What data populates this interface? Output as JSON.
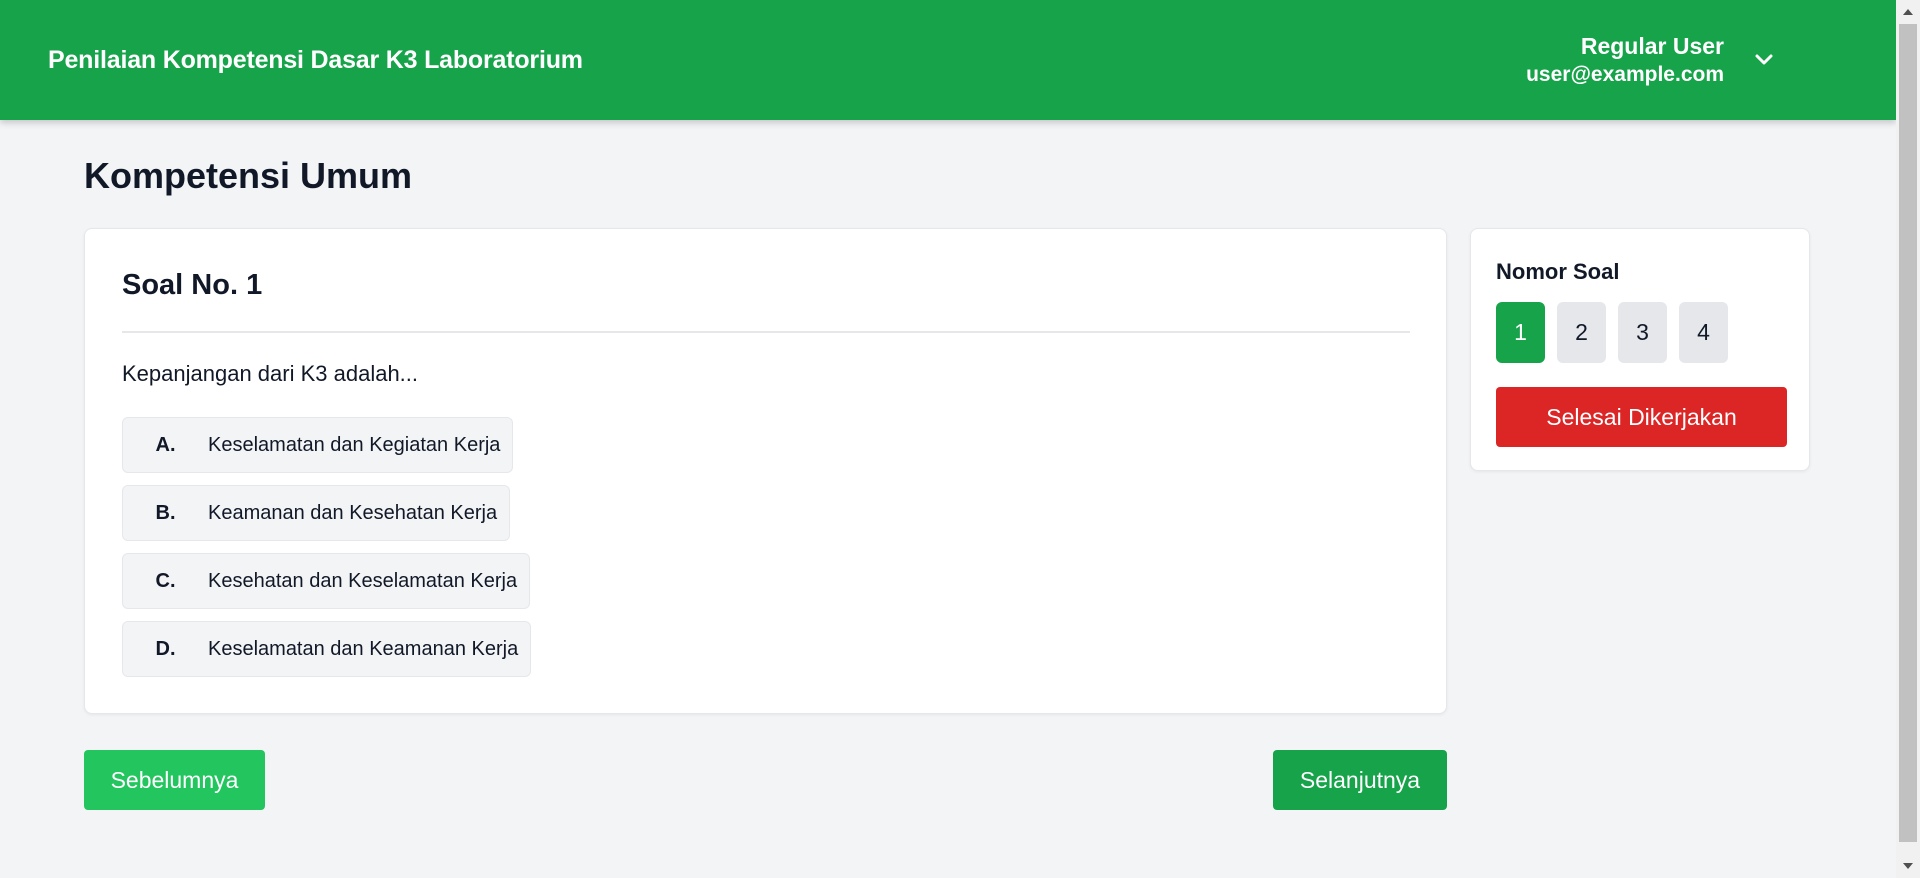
{
  "header": {
    "app_title": "Penilaian Kompetensi Dasar K3 Laboratorium",
    "user_name": "Regular User",
    "user_email": "user@example.com",
    "menu_icon": "chevron-down-icon"
  },
  "section": {
    "title": "Kompetensi Umum"
  },
  "question": {
    "number_label": "Soal No. 1",
    "text": "Kepanjangan dari K3 adalah...",
    "options": [
      {
        "letter": "A.",
        "text": "Keselamatan dan Kegiatan Kerja"
      },
      {
        "letter": "B.",
        "text": "Keamanan dan Kesehatan Kerja"
      },
      {
        "letter": "C.",
        "text": "Kesehatan dan Keselamatan Kerja"
      },
      {
        "letter": "D.",
        "text": "Keselamatan dan Keamanan Kerja"
      }
    ]
  },
  "navigation": {
    "prev_label": "Sebelumnya",
    "next_label": "Selanjutnya"
  },
  "sidebar": {
    "title": "Nomor Soal",
    "numbers": [
      "1",
      "2",
      "3",
      "4"
    ],
    "active_number": "1",
    "finish_label": "Selesai Dikerjakan"
  },
  "colors": {
    "primary_green": "#16a34a",
    "light_green": "#22c55e",
    "danger_red": "#dc2626",
    "background": "#f3f4f6"
  }
}
